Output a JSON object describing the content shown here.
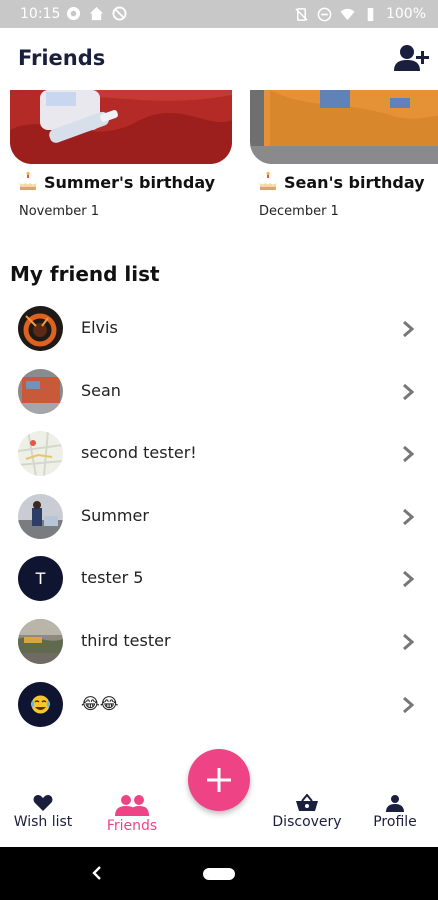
{
  "status_bar": {
    "time": "10:15",
    "battery": "100%"
  },
  "header": {
    "title": "Friends",
    "add_friend_icon": "person-add-icon"
  },
  "birthdays": [
    {
      "name": "Summer's birthday",
      "date": "November 1",
      "icon": "cake-icon"
    },
    {
      "name": "Sean's birthday",
      "date": "December 1",
      "icon": "cake-icon"
    }
  ],
  "friend_list": {
    "title": "My friend list",
    "items": [
      {
        "name": "Elvis"
      },
      {
        "name": "Sean"
      },
      {
        "name": "second tester!"
      },
      {
        "name": "Summer"
      },
      {
        "name": "tester 5",
        "initial": "T"
      },
      {
        "name": "third tester"
      },
      {
        "name": "😂😂"
      }
    ]
  },
  "fab": {
    "icon": "plus-icon"
  },
  "bottom_nav": {
    "wish_list": "Wish list",
    "friends": "Friends",
    "discovery": "Discovery",
    "profile": "Profile"
  },
  "colors": {
    "accent": "#ee4486",
    "navy": "#1a1f3d",
    "status_bar": "#c8c8c8"
  }
}
